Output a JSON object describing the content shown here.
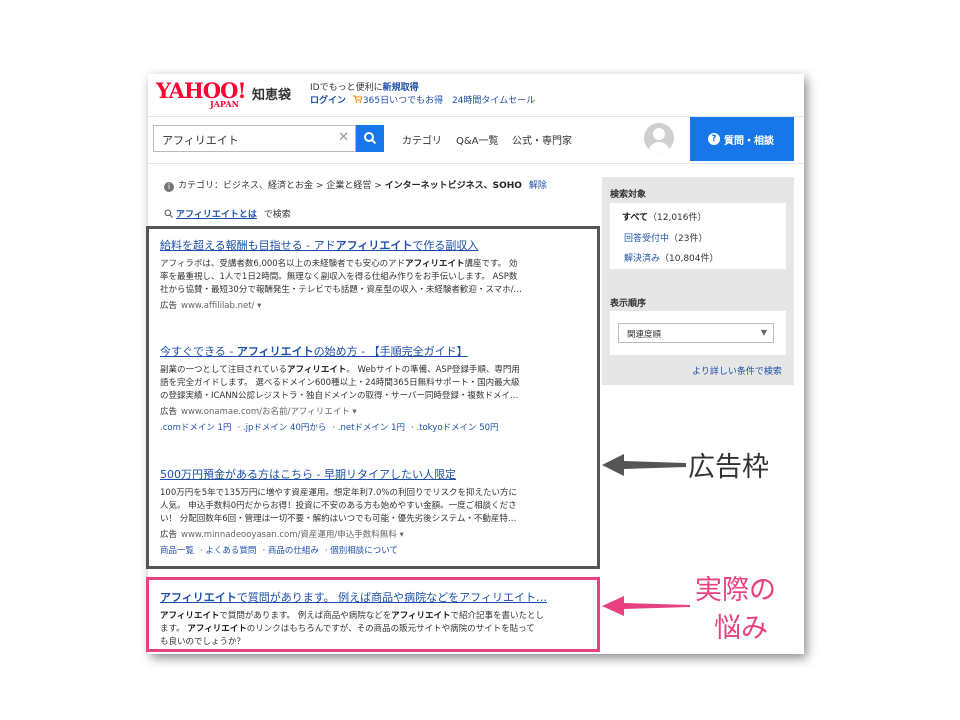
{
  "header": {
    "logo_text": "YAHOO!",
    "logo_sub": "JAPAN",
    "service_name": "知恵袋",
    "promo_line1": "IDでもっと便利に",
    "promo_signup": "新規取得",
    "login": "ログイン",
    "promo_deal": "365日いつでもお得",
    "promo_timesale": "24時間タイムセール"
  },
  "search": {
    "value": "アフィリエイト",
    "nav": [
      "カテゴリ",
      "Q&A一覧",
      "公式・専門家"
    ],
    "ask_button": "質問・相談"
  },
  "breadcrumb": {
    "prefix": "カテゴリ：ビジネス、経済とお金",
    "sep": ">",
    "level2": "企業と経営",
    "current": "インターネットビジネス、SOHO",
    "remove": "解除"
  },
  "search_query": {
    "link": "アフィリエイトとは",
    "suffix": "で検索"
  },
  "ads": [
    {
      "title_pre": "給料を超える報酬も目指せる - アド",
      "title_bold": "アフィリエイト",
      "title_post": "で作る副収入",
      "desc_line1_pre": "アフィラボは、受講者数6,000名以上の未経験者でも安心のアド",
      "desc_line1_bold": "アフィリエイト",
      "desc_line1_post": "講座です。 効",
      "desc_line2": "率を最重視し、1人で1日2時間。無理なく副収入を得る仕組み作りをお手伝いします。 ASP数",
      "desc_line3": "社から協賛・最短30分で報酬発生・テレビでも話題・資産型の収入・未経験者歓迎・スマホ/…",
      "ad_label": "広告",
      "url": "www.affililab.net/"
    },
    {
      "title_pre": "今すぐできる - ",
      "title_bold": "アフィリエイト",
      "title_post": "の始め方 - 【手順完全ガイド】",
      "desc_line1_pre": "副業の一つとして注目されている",
      "desc_line1_bold": "アフィリエイト",
      "desc_line1_post": "。 Webサイトの準備、ASP登録手順、専門用",
      "desc_line2": "語を完全ガイドします。 選べるドメイン600種以上・24時間365日無料サポート・国内最大級",
      "desc_line3": "の登録実績・ICANN公認レジストラ・独自ドメインの取得・サーバー同時登録・複数ドメイ…",
      "ad_label": "広告",
      "url": "www.onamae.com/お名前/アフィリエイト",
      "sitelinks": [
        ".comドメイン 1円",
        ".jpドメイン 40円から",
        ".netドメイン 1円",
        ".tokyoドメイン 50円"
      ]
    },
    {
      "title": "500万円預金がある方はこちら - 早期リタイアしたい人限定",
      "desc_line1": "100万円を5年で135万円に増やす資産運用。想定年利7.0%の利回りでリスクを抑えたい方に",
      "desc_line2": "人気。 申込手数料0円だからお得！投資に不安のある方も始めやすい金額。一度ご相談くださ",
      "desc_line3": "い！ 分配回数年6回・管理は一切不要・解約はいつでも可能・優先劣後システム・不動産特…",
      "ad_label": "広告",
      "url": "www.minnadeooyasan.com/資産運用/申込手数料無料",
      "sitelinks": [
        "商品一覧",
        "よくある質問",
        "商品の仕組み",
        "個別相談について"
      ]
    }
  ],
  "answer": {
    "title_bold": "アフィリエイト",
    "title_rest": "で質問があります。 例えば商品や病院などをアフィリエイト…",
    "desc_line1_b1": "アフィリエイト",
    "desc_line1_mid": "で質問があります。 例えば商品や病院などを",
    "desc_line1_b2": "アフィリエイト",
    "desc_line1_post": "で紹介記事を書いたとし",
    "desc_line2_pre": "ます。 ",
    "desc_line2_bold": "アフィリエイト",
    "desc_line2_post": "のリンクはもちろんですが、その商品の販元サイトや病院のサイトを貼って",
    "desc_line3": "も良いのでしょうか？"
  },
  "sidebar": {
    "target_heading": "検索対象",
    "items": [
      {
        "label": "すべて",
        "count": "（12,016件）"
      },
      {
        "label": "回答受付中",
        "count": "（23件）"
      },
      {
        "label": "解決済み",
        "count": "（10,804件）"
      }
    ],
    "order_heading": "表示順序",
    "order_selected": "関連度順",
    "advanced": "より詳しい条件で検索"
  },
  "callouts": {
    "ad_frame": "広告枠",
    "real_worry_line1": "実際の",
    "real_worry_line2": "悩み"
  },
  "colors": {
    "brand_red": "#ff0033",
    "accent_blue": "#1877e8",
    "link_blue": "#1d4fa8",
    "ad_box": "#555555",
    "highlight_pink": "#e8417f"
  }
}
